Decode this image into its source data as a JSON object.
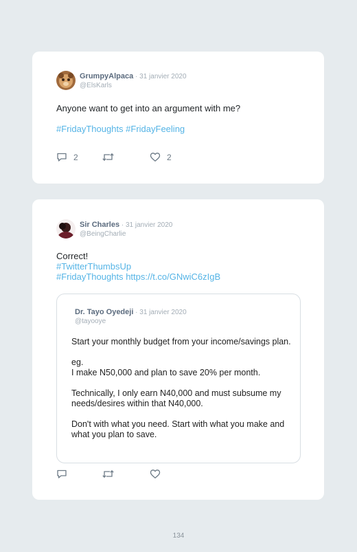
{
  "tweet1": {
    "name": "GrumpyAlpaca",
    "separator": " · ",
    "date": "31 janvier 2020",
    "handle": "@ElsKarls",
    "text": "Anyone want to get into an argument with me?",
    "hashtags": "#FridayThoughts #FridayFeeling",
    "replies": "2",
    "likes": "2"
  },
  "tweet2": {
    "name": "Sir Charles",
    "separator": " · ",
    "date": "31 janvier 2020",
    "handle": "@BeingCharlie",
    "text": "Correct!",
    "hashtag1": "#TwitterThumbsUp",
    "hashtag2": "#FridayThoughts",
    "link": "https://t.co/GNwiC6zIgB",
    "quoted": {
      "name": "Dr. Tayo Oyedeji",
      "separator": " · ",
      "date": "31 janvier 2020",
      "handle": "@tayooye",
      "p1": "Start your monthly budget from your income/savings plan.",
      "p2a": "eg.",
      "p2b": "I make N50,000 and plan to save 20% per month.",
      "p3": "Technically, I only earn N40,000 and must subsume my needs/desires within that N40,000.",
      "p4": "Don't with what you need. Start with what you make and what you plan to save."
    }
  },
  "page_number": "134",
  "icons": {
    "reply": "reply-icon",
    "retweet": "retweet-icon",
    "like": "heart-icon"
  },
  "colors": {
    "background": "#e6ebee",
    "card": "#ffffff",
    "link": "#55b4e6",
    "name": "#5b6b7e",
    "muted": "#a3adb6"
  }
}
